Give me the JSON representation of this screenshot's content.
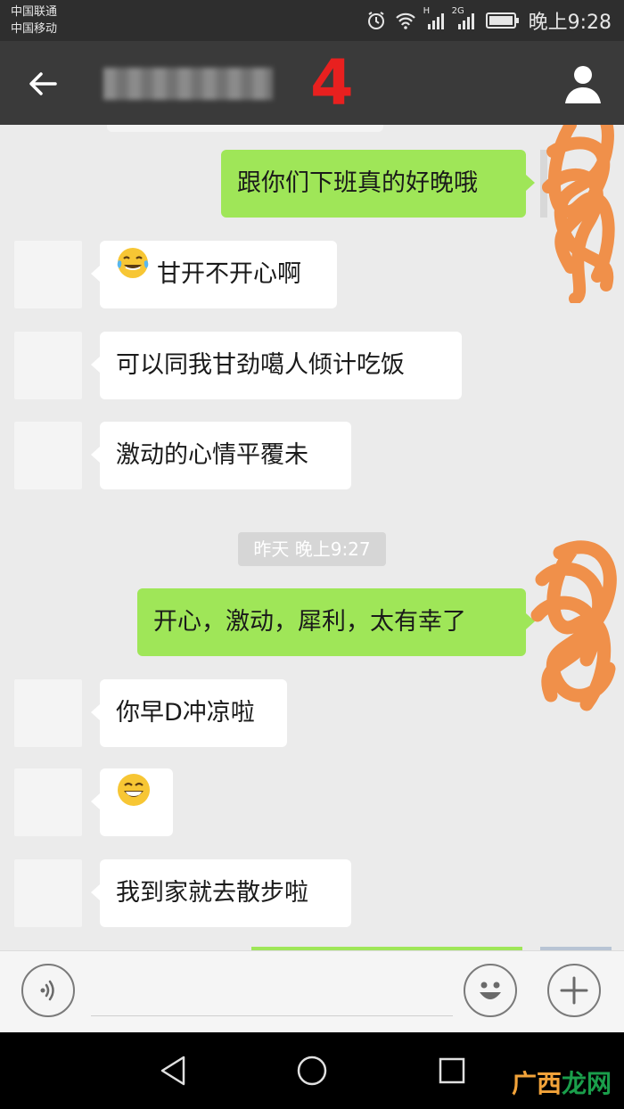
{
  "status_bar": {
    "carrier_1": "中国联通",
    "carrier_2": "中国移动",
    "network_1": "H",
    "network_2": "2G",
    "time": "晚上9:28"
  },
  "title_bar": {
    "title": "",
    "annotation_number": "4"
  },
  "messages": [
    {
      "side": "out",
      "text": "跟你们下班真的好晚哦"
    },
    {
      "side": "in",
      "emoji": "laughing-tears",
      "text": "甘开不开心啊"
    },
    {
      "side": "in",
      "text": "可以同我甘劲噶人倾计吃饭"
    },
    {
      "side": "in",
      "text": "激动的心情平覆未"
    },
    {
      "type": "timestamp",
      "text": "昨天 晚上9:27"
    },
    {
      "side": "out",
      "text": "开心，激动，犀利，太有幸了"
    },
    {
      "side": "in",
      "text": "你早D冲凉啦"
    },
    {
      "side": "in",
      "emoji": "grinning",
      "text": ""
    },
    {
      "side": "in",
      "text": "我到家就去散步啦"
    }
  ],
  "watermark": {
    "part_1": "广西",
    "part_2": "龙网"
  },
  "colors": {
    "outgoing_bubble": "#9fe658",
    "incoming_bubble": "#ffffff",
    "chat_background": "#ebebeb",
    "title_bar": "#3a3a3a",
    "annotation": "#e8201f",
    "scribble": "#f0904a"
  }
}
